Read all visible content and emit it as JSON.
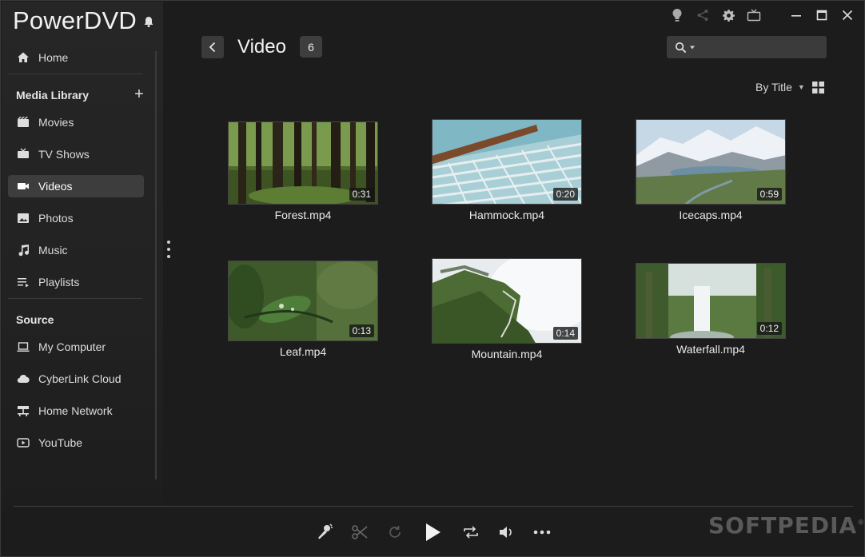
{
  "app": {
    "name": "PowerDVD"
  },
  "sidebar": {
    "home": "Home",
    "media_library_label": "Media Library",
    "library_items": [
      {
        "label": "Movies",
        "icon": "film-icon"
      },
      {
        "label": "TV Shows",
        "icon": "tv-icon"
      },
      {
        "label": "Videos",
        "icon": "video-camera-icon",
        "active": true
      },
      {
        "label": "Photos",
        "icon": "photo-icon"
      },
      {
        "label": "Music",
        "icon": "music-note-icon"
      },
      {
        "label": "Playlists",
        "icon": "playlist-icon"
      }
    ],
    "source_label": "Source",
    "source_items": [
      {
        "label": "My Computer",
        "icon": "laptop-icon"
      },
      {
        "label": "CyberLink Cloud",
        "icon": "cloud-icon"
      },
      {
        "label": "Home Network",
        "icon": "network-icon"
      },
      {
        "label": "YouTube",
        "icon": "youtube-icon"
      }
    ]
  },
  "header": {
    "title": "Video",
    "count": "6",
    "search_placeholder": "",
    "sort_label": "By Title"
  },
  "videos": [
    {
      "name": "Forest.mp4",
      "duration": "0:31"
    },
    {
      "name": "Hammock.mp4",
      "duration": "0:20"
    },
    {
      "name": "Icecaps.mp4",
      "duration": "0:59"
    },
    {
      "name": "Leaf.mp4",
      "duration": "0:13"
    },
    {
      "name": "Mountain.mp4",
      "duration": "0:14"
    },
    {
      "name": "Waterfall.mp4",
      "duration": "0:12"
    }
  ],
  "watermark": {
    "text": "SOFTPEDIA",
    "mark": "®"
  },
  "colors": {
    "background": "#1c1c1c",
    "sidebar": "#262626",
    "active_item": "#3d3d3d",
    "accent_text": "#f2f2f2"
  }
}
